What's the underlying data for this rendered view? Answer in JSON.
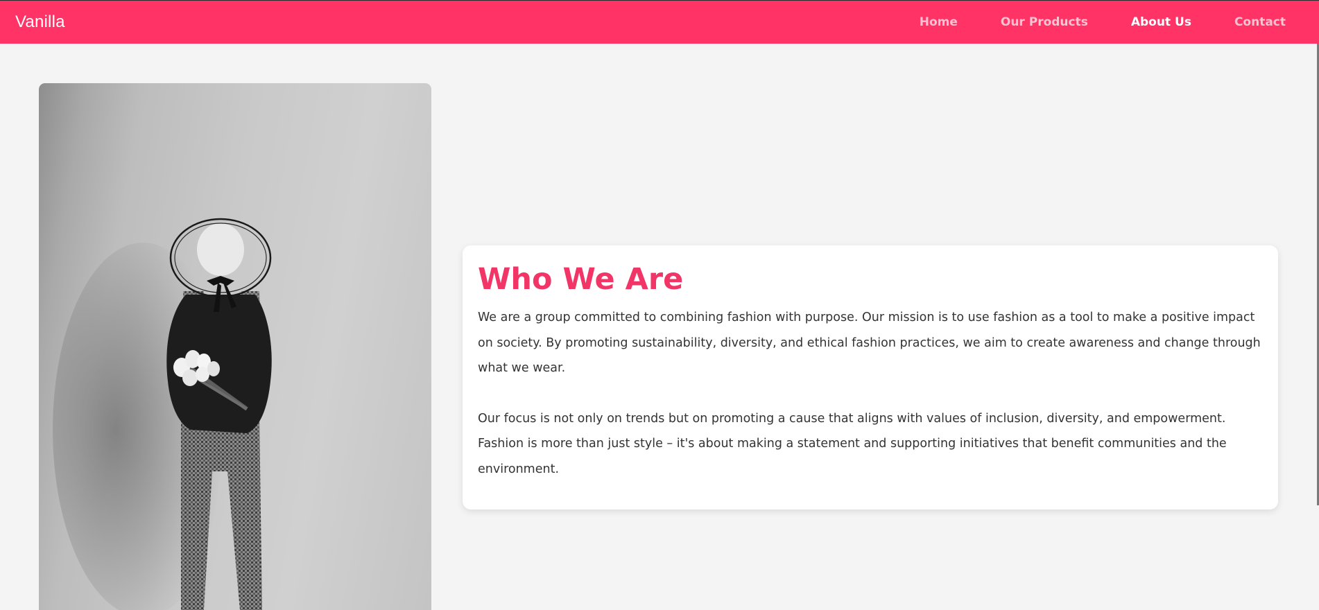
{
  "navbar": {
    "brand": "Vanilla",
    "links": [
      {
        "label": "Home",
        "active": false
      },
      {
        "label": "Our Products",
        "active": false
      },
      {
        "label": "About Us",
        "active": true
      },
      {
        "label": "Contact",
        "active": false
      }
    ]
  },
  "about": {
    "title": "Who We Are",
    "paragraphs": [
      "We are a group committed to combining fashion with purpose. Our mission is to use fashion as a tool to make a positive impact on society. By promoting sustainability, diversity, and ethical fashion practices, we aim to create awareness and change through what we wear.",
      "Our focus is not only on trends but on promoting a cause that aligns with values of inclusion, diversity, and empowerment. Fashion is more than just style – it's about making a statement and supporting initiatives that benefit communities and the environment."
    ]
  },
  "image": {
    "subject": "black-and-white photo of a person in a wide-brim hat holding tulips behind their back"
  },
  "colors": {
    "brand": "#ff3366",
    "title": "#f23567",
    "background": "#f4f4f4"
  }
}
